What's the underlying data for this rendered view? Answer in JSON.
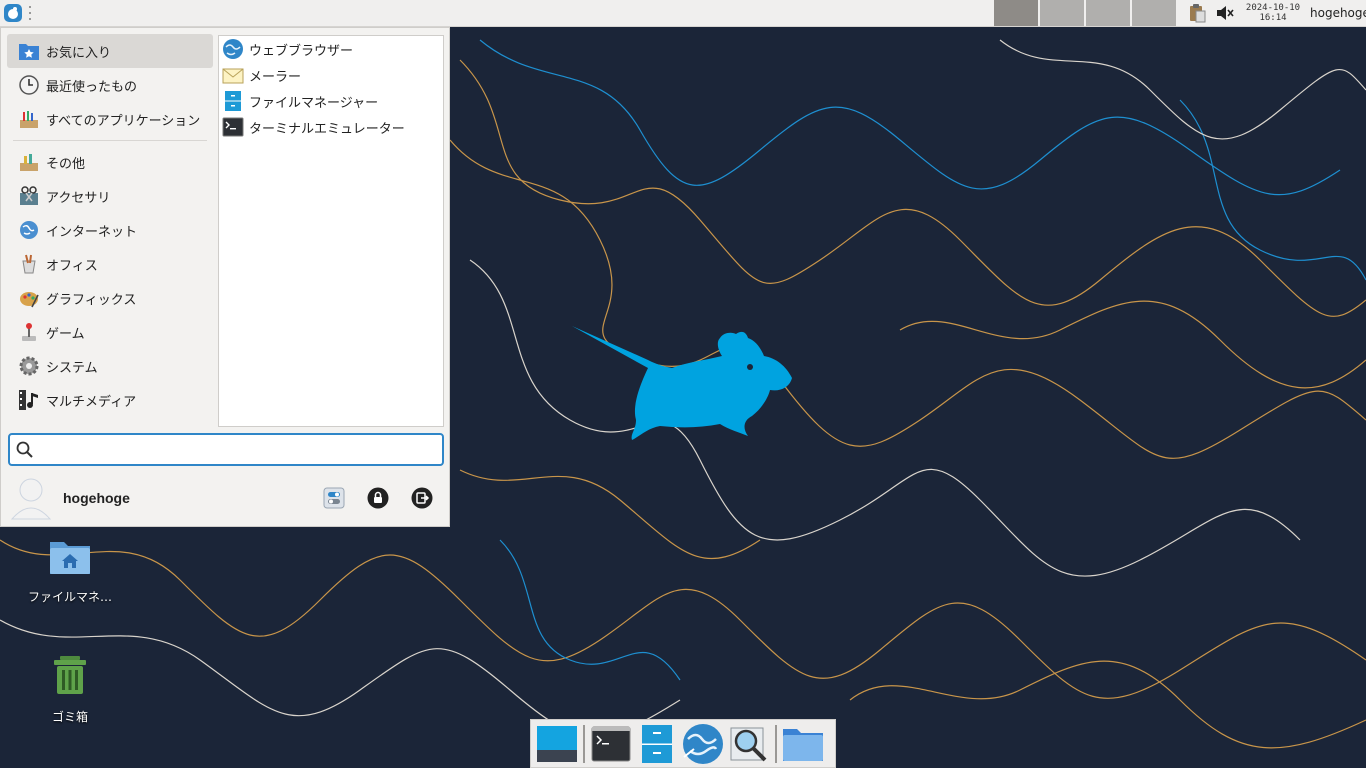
{
  "colors": {
    "desktop_bg": "#1b2538",
    "accent": "#2f86c8",
    "mouse_blue": "#00a3e0",
    "contour_orange": "#c8954a",
    "contour_blue": "#1e8fd0"
  },
  "top_panel": {
    "menu_icon": "xfce-mouse-icon",
    "workspaces": [
      "",
      "",
      "",
      ""
    ],
    "tray_icons": [
      "clipboard-icon",
      "volume-muted-icon"
    ],
    "clock_date": "2024-10-10",
    "clock_time": "16:14",
    "user": "hogehoge"
  },
  "whisker_menu": {
    "categories_top": [
      {
        "label": "お気に入り",
        "icon": "star-folder-icon",
        "selected": true
      },
      {
        "label": "最近使ったもの",
        "icon": "clock-icon"
      },
      {
        "label": "すべてのアプリケーション",
        "icon": "applications-icon"
      }
    ],
    "categories": [
      {
        "label": "その他",
        "icon": "other-icon"
      },
      {
        "label": "アクセサリ",
        "icon": "accessories-icon"
      },
      {
        "label": "インターネット",
        "icon": "globe-icon"
      },
      {
        "label": "オフィス",
        "icon": "office-icon"
      },
      {
        "label": "グラフィックス",
        "icon": "graphics-icon"
      },
      {
        "label": "ゲーム",
        "icon": "joystick-icon"
      },
      {
        "label": "システム",
        "icon": "gear-icon"
      },
      {
        "label": "マルチメディア",
        "icon": "film-music-icon"
      }
    ],
    "apps": [
      {
        "label": "ウェブブラウザー",
        "icon": "web-browser-icon"
      },
      {
        "label": "メーラー",
        "icon": "mail-icon"
      },
      {
        "label": "ファイルマネージャー",
        "icon": "file-manager-icon"
      },
      {
        "label": "ターミナルエミュレーター",
        "icon": "terminal-icon"
      }
    ],
    "search_placeholder": "",
    "search_value": "",
    "username": "hogehoge"
  },
  "desktop_icons": [
    {
      "label": "ファイルマネ…",
      "icon": "home-folder-icon"
    },
    {
      "label": "ゴミ箱",
      "icon": "trash-icon"
    }
  ],
  "dock": {
    "items": [
      "show-desktop-icon",
      "terminal-icon",
      "file-manager-icon",
      "web-browser-icon",
      "app-finder-icon",
      "folder-icon"
    ]
  }
}
